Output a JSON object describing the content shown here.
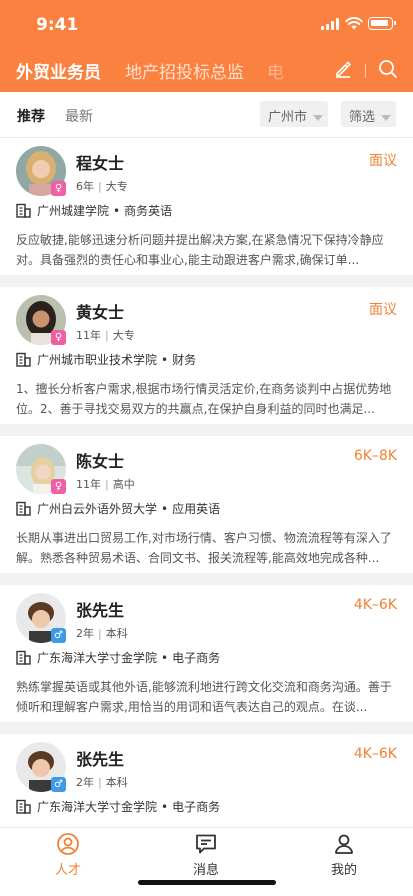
{
  "status": {
    "time": "9:41"
  },
  "nav": {
    "tabs": [
      "外贸业务员",
      "地产招投标总监",
      "电"
    ]
  },
  "filter": {
    "tabs": [
      "推荐",
      "最新"
    ],
    "city": "广州市",
    "filter_label": "筛选"
  },
  "candidates": [
    {
      "name": "程女士",
      "gender": "female",
      "salary": "面议",
      "years": "6年",
      "education": "大专",
      "school": "广州城建学院",
      "major": "商务英语",
      "desc": "反应敏捷,能够迅速分析问题并提出解决方案,在紧急情况下保持冷静应对。具备强烈的责任心和事业心,能主动跟进客户需求,确保订单..."
    },
    {
      "name": "黄女士",
      "gender": "female",
      "salary": "面议",
      "years": "11年",
      "education": "大专",
      "school": "广州城市职业技术学院",
      "major": "财务",
      "desc": "1、擅长分析客户需求,根据市场行情灵活定价,在商务谈判中占据优势地位。2、善于寻找交易双方的共赢点,在保护自身利益的同时也满足..."
    },
    {
      "name": "陈女士",
      "gender": "female",
      "salary": "6K–8K",
      "years": "11年",
      "education": "高中",
      "school": "广州白云外语外贸大学",
      "major": "应用英语",
      "desc": "长期从事进出口贸易工作,对市场行情、客户习惯、物流流程等有深入了解。熟悉各种贸易术语、合同文书、报关流程等,能高效地完成各种..."
    },
    {
      "name": "张先生",
      "gender": "male",
      "salary": "4K–6K",
      "years": "2年",
      "education": "本科",
      "school": "广东海洋大学寸金学院",
      "major": "电子商务",
      "desc": "熟练掌握英语或其他外语,能够流利地进行跨文化交流和商务沟通。善于倾听和理解客户需求,用恰当的用词和语气表达自己的观点。在谈..."
    },
    {
      "name": "张先生",
      "gender": "male",
      "salary": "4K–6K",
      "years": "2年",
      "education": "本科",
      "school": "广东海洋大学寸金学院",
      "major": "电子商务",
      "desc": ""
    }
  ],
  "tabbar": [
    "人才",
    "消息",
    "我的"
  ],
  "colors": {
    "accent": "#fb8140",
    "salary": "#f08236",
    "female": "#ee5fa4",
    "male": "#3e9ae9"
  },
  "icons": [
    "signal-icon",
    "wifi-icon",
    "battery-icon",
    "edit-icon",
    "search-icon",
    "building-icon",
    "female-icon",
    "male-icon",
    "talent-icon",
    "message-icon",
    "profile-icon"
  ]
}
